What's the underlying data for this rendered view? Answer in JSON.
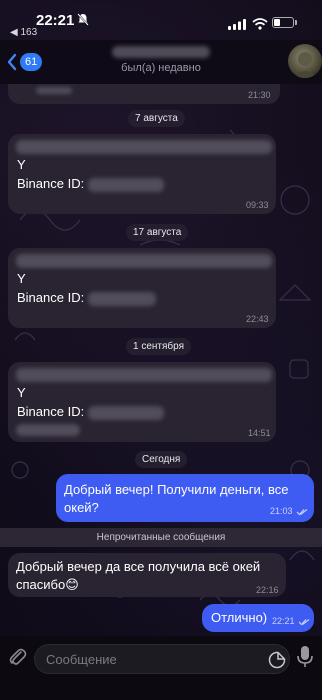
{
  "status_bar": {
    "time": "22:21",
    "back_app": "◀ 163"
  },
  "header": {
    "back_count": "61",
    "contact_status": "был(а) недавно"
  },
  "messages": [
    {
      "id": "m0",
      "time": "21:30"
    },
    {
      "id": "m1",
      "date": "7 августа",
      "line1": "Y",
      "line2": "Binance ID:",
      "time": "09:33"
    },
    {
      "id": "m2",
      "date": "17 августа",
      "line1": "Y",
      "line2": "Binance ID:",
      "time": "22:43"
    },
    {
      "id": "m3",
      "date": "1 сентября",
      "line1": "Y",
      "line2": "Binance ID:",
      "time": "14:51"
    },
    {
      "id": "m4",
      "date": "Сегодня",
      "line1": "Добрый вечер! Получили деньги, все",
      "line2": "окей?",
      "time": "21:03"
    },
    {
      "id": "m5",
      "line1": "Добрый вечер да все получила всё окей",
      "line2": "спасибо😊",
      "time": "22:16"
    },
    {
      "id": "m6",
      "line1": "Отлично)",
      "time": "22:21"
    }
  ],
  "unread_label": "Непрочитанные сообщения",
  "input": {
    "placeholder": "Сообщение"
  },
  "colors": {
    "outgoing_bubble": "#3f5cf2",
    "incoming_bubble": "#2a2432",
    "badge": "#2f7af7"
  }
}
